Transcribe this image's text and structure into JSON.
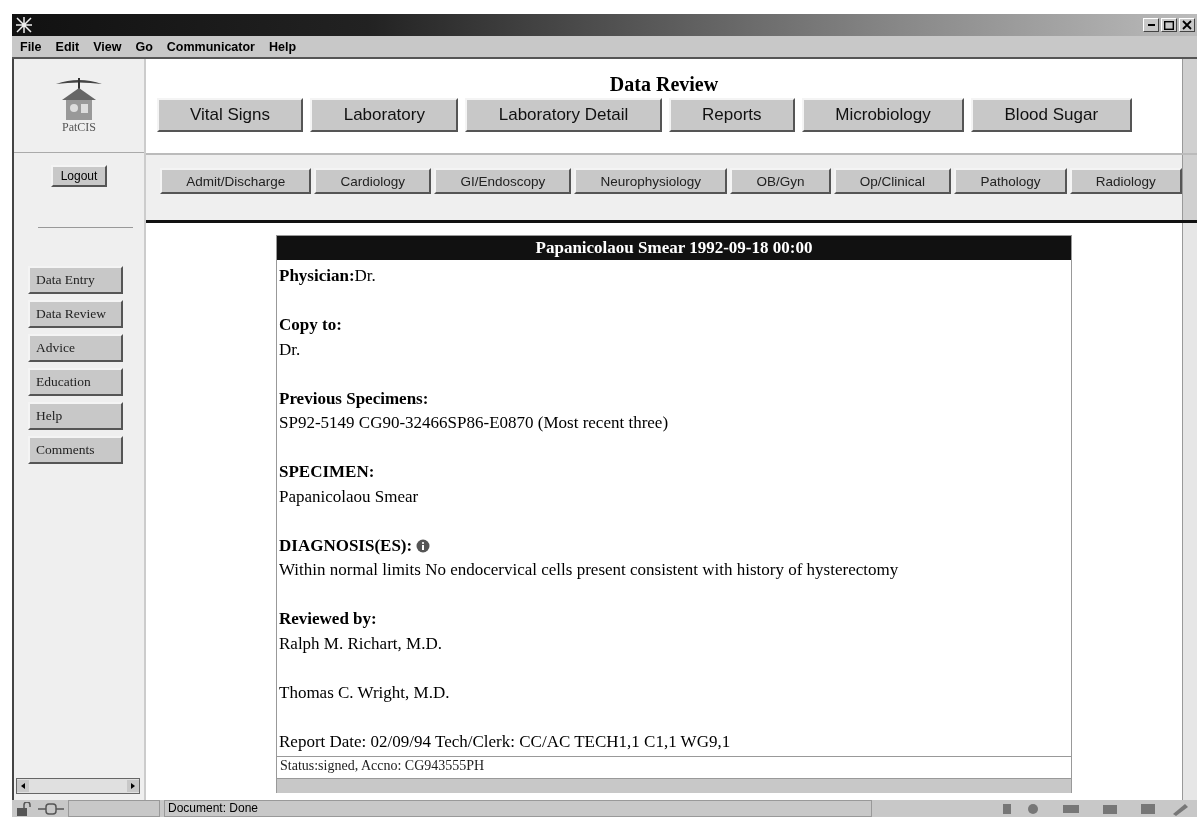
{
  "menu": [
    "File",
    "Edit",
    "View",
    "Go",
    "Communicator",
    "Help"
  ],
  "logo_text": "PatCIS",
  "header": {
    "title": "Data Review",
    "tabs": [
      {
        "label": "Vital Signs"
      },
      {
        "label": "Laboratory"
      },
      {
        "label": "Laboratory Detail"
      },
      {
        "label": "Reports"
      },
      {
        "label": "Microbiology"
      },
      {
        "label": "Blood Sugar"
      }
    ]
  },
  "logout": "Logout",
  "subtabs": [
    "Admit/Discharge",
    "Cardiology",
    "GI/Endoscopy",
    "Neurophysiology",
    "OB/Gyn",
    "Op/Clinical",
    "Pathology",
    "Radiology"
  ],
  "sidebar": [
    "Data Entry",
    "Data Review",
    "Advice",
    "Education",
    "Help",
    "Comments"
  ],
  "report": {
    "title": "Papanicolaou Smear 1992-09-18 00:00",
    "sections": [
      {
        "kind": "inline",
        "label": "Physician:",
        "text": "Dr."
      },
      {
        "kind": "block",
        "label": "Copy to:",
        "text": "Dr."
      },
      {
        "kind": "block",
        "label": "Previous Specimens:",
        "text": "SP92-5149 CG90-32466SP86-E0870 (Most recent three)"
      },
      {
        "kind": "block",
        "label": "SPECIMEN:",
        "text": "Papanicolaou Smear"
      },
      {
        "kind": "block",
        "label": "DIAGNOSIS(ES):",
        "info": true,
        "text": "Within normal limits No endocervical cells present consistent with history of hysterectomy"
      },
      {
        "kind": "block",
        "label": "Reviewed by:",
        "text": "Ralph M. Richart, M.D."
      },
      {
        "kind": "plain",
        "text": "Thomas C. Wright, M.D."
      },
      {
        "kind": "plain",
        "text": "Report Date: 02/09/94 Tech/Clerk: CC/AC TECH1,1 C1,1 WG9,1"
      }
    ],
    "status": "Status:signed, Accno: CG943555PH"
  },
  "status_bar": {
    "text": "Document: Done"
  }
}
